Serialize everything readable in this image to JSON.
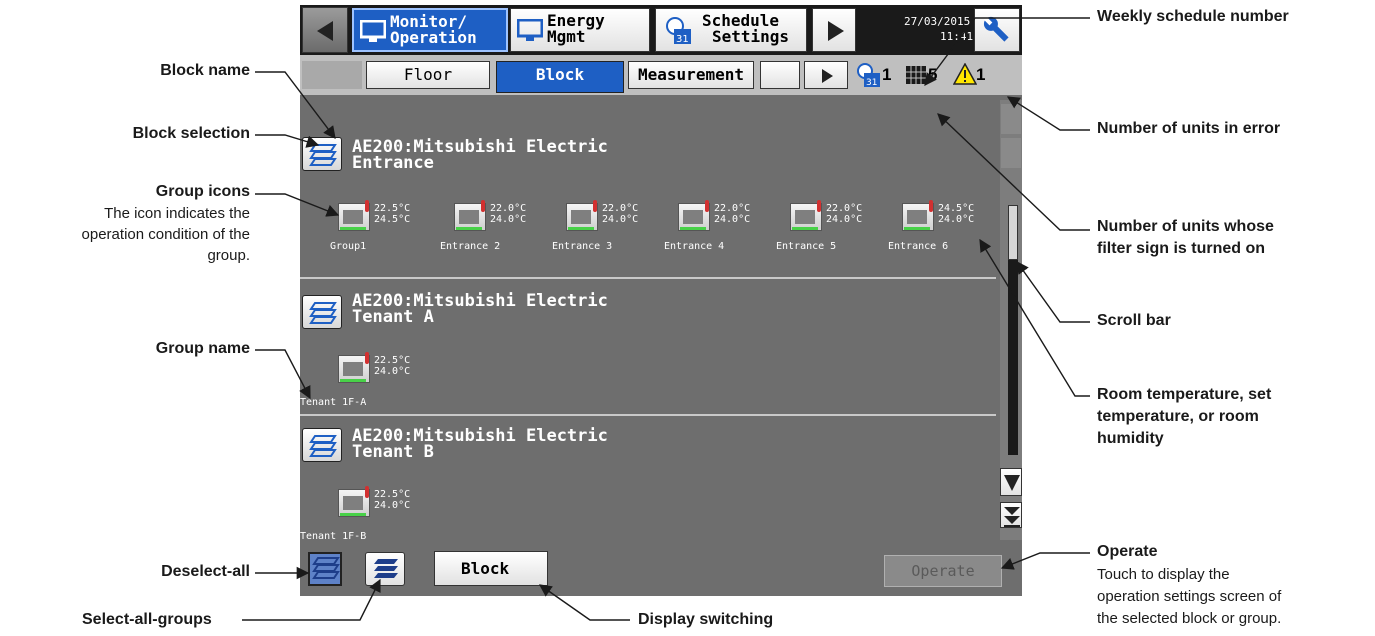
{
  "header": {
    "tabs": [
      {
        "line1": "Monitor/",
        "line2": "Operation"
      },
      {
        "line1": "Energy",
        "line2": "Mgmt"
      },
      {
        "line1": "Schedule",
        "line2": "Settings"
      }
    ],
    "date": "27/03/2015",
    "time": "11:41"
  },
  "subtabs": [
    "Floor",
    "Block",
    "Measurement"
  ],
  "status": {
    "schedule_count": "1",
    "filter_count": "5",
    "error_count": "1"
  },
  "blocks": [
    {
      "name_line1": "AE200:Mitsubishi Electric",
      "name_line2": "Entrance",
      "groups": [
        {
          "name": "Group1",
          "t1": "22.5°C",
          "t2": "24.5°C"
        },
        {
          "name": "Entrance 2",
          "t1": "22.0°C",
          "t2": "24.0°C"
        },
        {
          "name": "Entrance 3",
          "t1": "22.0°C",
          "t2": "24.0°C"
        },
        {
          "name": "Entrance 4",
          "t1": "22.0°C",
          "t2": "24.0°C"
        },
        {
          "name": "Entrance 5",
          "t1": "22.0°C",
          "t2": "24.0°C"
        },
        {
          "name": "Entrance 6",
          "t1": "24.5°C",
          "t2": "24.0°C"
        }
      ]
    },
    {
      "name_line1": "AE200:Mitsubishi Electric",
      "name_line2": "Tenant A",
      "groups": [
        {
          "name": "Tenant 1F-A",
          "t1": "22.5°C",
          "t2": "24.0°C"
        }
      ]
    },
    {
      "name_line1": "AE200:Mitsubishi Electric",
      "name_line2": "Tenant B",
      "groups": [
        {
          "name": "Tenant 1F-B",
          "t1": "22.5°C",
          "t2": "24.0°C"
        }
      ]
    }
  ],
  "footer": {
    "display_switch": "Block",
    "operate": "Operate"
  },
  "callouts": {
    "block_name": "Block name",
    "block_selection": "Block selection",
    "group_icons": "Group icons",
    "group_icons_desc1": "The icon indicates the",
    "group_icons_desc2": "operation condition of the",
    "group_icons_desc3": "group.",
    "group_name": "Group name",
    "deselect_all": "Deselect-all",
    "select_all_groups": "Select-all-groups",
    "display_switching": "Display switching",
    "weekly_schedule": "Weekly schedule number",
    "units_in_error": "Number of units in error",
    "filter_sign1": "Number of units whose",
    "filter_sign2": "filter sign is turned on",
    "scroll_bar": "Scroll bar",
    "room_temp1": "Room temperature, set",
    "room_temp2": "temperature, or room",
    "room_temp3": "humidity",
    "operate": "Operate",
    "operate_desc1": "Touch to display the",
    "operate_desc2": "operation settings screen of",
    "operate_desc3": "the selected block or group."
  },
  "colors": {
    "active_tab": "#1e5fc4",
    "screen_bg": "#6e6e6e",
    "header_bg": "#1a1a1a",
    "status_green": "#48d148"
  }
}
